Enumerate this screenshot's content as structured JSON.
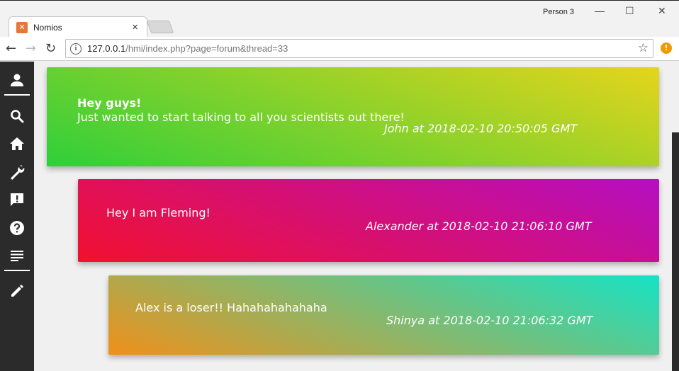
{
  "browser": {
    "tab_title": "Nomios",
    "tab_close": "×",
    "profile": "Person 3",
    "window_minimize": "—",
    "window_maximize": "☐",
    "window_close": "✕",
    "url_host": "127.0.0.1",
    "url_path": "/hmi/index.php?page=forum&thread=33"
  },
  "sidebar": {
    "items": [
      {
        "name": "profile-icon"
      },
      {
        "name": "search-icon"
      },
      {
        "name": "home-icon"
      },
      {
        "name": "wrench-icon"
      },
      {
        "name": "report-icon"
      },
      {
        "name": "help-icon"
      },
      {
        "name": "list-icon"
      },
      {
        "name": "edit-icon"
      }
    ]
  },
  "posts": [
    {
      "greeting": "Hey guys!",
      "body": "Just wanted to start talking to all you scientists out there!",
      "meta": "John at 2018-02-10 20:50:05 GMT",
      "gradient": [
        "#2fcf3a",
        "#e5d41c"
      ]
    },
    {
      "body": "Hey I am Fleming!",
      "meta": "Alexander at 2018-02-10 21:06:10 GMT",
      "gradient": [
        "#f2102e",
        "#b50fc2"
      ]
    },
    {
      "body": "Alex is a loser!! Hahahahahahaha",
      "meta": "Shinya at 2018-02-10 21:06:32 GMT",
      "gradient": [
        "#f0901a",
        "#16e3c6"
      ]
    }
  ]
}
